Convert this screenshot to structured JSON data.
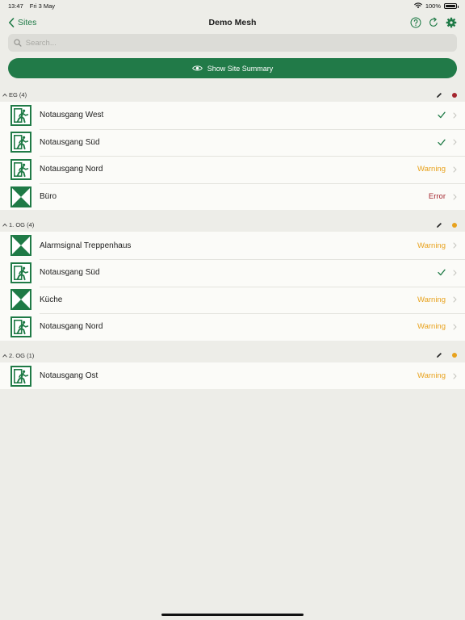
{
  "status_bar": {
    "time": "13:47",
    "date": "Fri 3 May",
    "battery": "100%"
  },
  "nav": {
    "back_label": "Sites",
    "title": "Demo Mesh",
    "help_icon": "help-circle-icon",
    "refresh_icon": "refresh-icon",
    "settings_icon": "gear-icon"
  },
  "search": {
    "placeholder": "Search...",
    "value": ""
  },
  "summary_button": {
    "label": "Show Site Summary",
    "icon": "eye-icon"
  },
  "colors": {
    "accent": "#217a48",
    "warning": "#e8a21d",
    "error": "#a4252e",
    "ok": "#1e7a46"
  },
  "sections": [
    {
      "title": "EG (4)",
      "indicator_color": "#a4252e",
      "items": [
        {
          "name": "Notausgang West",
          "type": "exit",
          "status": "ok",
          "status_text": ""
        },
        {
          "name": "Notausgang Süd",
          "type": "exit",
          "status": "ok",
          "status_text": ""
        },
        {
          "name": "Notausgang Nord",
          "type": "exit",
          "status": "warning",
          "status_text": "Warning"
        },
        {
          "name": "Büro",
          "type": "alarm",
          "status": "error",
          "status_text": "Error"
        }
      ]
    },
    {
      "title": "1. OG (4)",
      "indicator_color": "#e8a21d",
      "items": [
        {
          "name": "Alarmsignal Treppenhaus",
          "type": "alarm",
          "status": "warning",
          "status_text": "Warning"
        },
        {
          "name": "Notausgang Süd",
          "type": "exit",
          "status": "ok",
          "status_text": ""
        },
        {
          "name": "Küche",
          "type": "alarm",
          "status": "warning",
          "status_text": "Warning"
        },
        {
          "name": "Notausgang Nord",
          "type": "exit",
          "status": "warning",
          "status_text": "Warning"
        }
      ]
    },
    {
      "title": "2. OG (1)",
      "indicator_color": "#e8a21d",
      "items": [
        {
          "name": "Notausgang Ost",
          "type": "exit",
          "status": "warning",
          "status_text": "Warning"
        }
      ]
    }
  ]
}
